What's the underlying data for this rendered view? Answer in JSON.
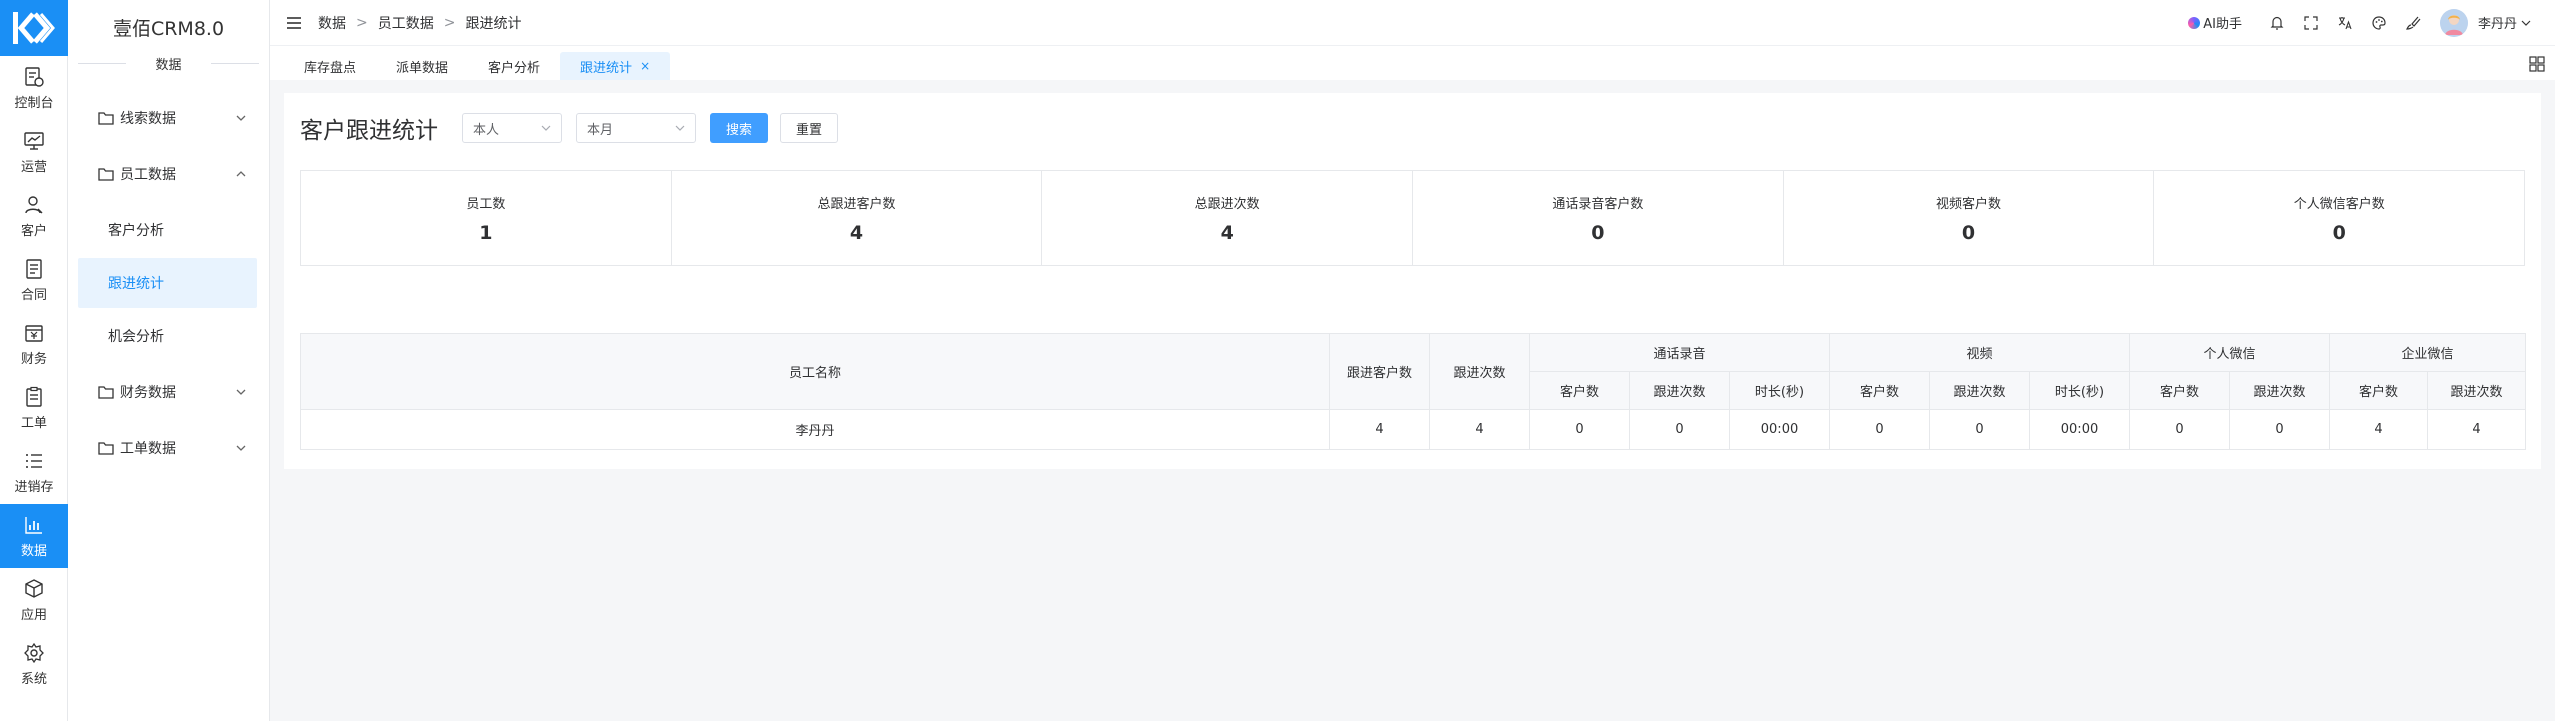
{
  "app": {
    "title": "壹佰CRM8.0",
    "section": "数据"
  },
  "rail": [
    {
      "label": "控制台",
      "icon": "dashboard-icon",
      "active": false
    },
    {
      "label": "运营",
      "icon": "chart-board-icon",
      "active": false
    },
    {
      "label": "客户",
      "icon": "user-icon",
      "active": false
    },
    {
      "label": "合同",
      "icon": "document-icon",
      "active": false
    },
    {
      "label": "财务",
      "icon": "finance-icon",
      "active": false
    },
    {
      "label": "工单",
      "icon": "clipboard-icon",
      "active": false
    },
    {
      "label": "进销存",
      "icon": "list-icon",
      "active": false
    },
    {
      "label": "数据",
      "icon": "bar-chart-icon",
      "active": true
    },
    {
      "label": "应用",
      "icon": "cube-icon",
      "active": false
    },
    {
      "label": "系统",
      "icon": "settings-icon",
      "active": false
    }
  ],
  "submenu": {
    "groups": [
      {
        "label": "线索数据",
        "expanded": false
      },
      {
        "label": "员工数据",
        "expanded": true,
        "children": [
          "客户分析",
          "跟进统计",
          "机会分析"
        ]
      },
      {
        "label": "财务数据",
        "expanded": false
      },
      {
        "label": "工单数据",
        "expanded": false
      }
    ]
  },
  "breadcrumb": [
    "数据",
    "员工数据",
    "跟进统计"
  ],
  "topbar": {
    "ai_label": "AI助手",
    "user_name": "李丹丹"
  },
  "tabs": [
    {
      "label": "库存盘点",
      "active": false
    },
    {
      "label": "派单数据",
      "active": false
    },
    {
      "label": "客户分析",
      "active": false
    },
    {
      "label": "跟进统计",
      "active": true,
      "close": "×"
    }
  ],
  "page": {
    "title": "客户跟进统计",
    "filter_scope": "本人",
    "filter_period": "本月",
    "search_label": "搜索",
    "reset_label": "重置"
  },
  "stats": [
    {
      "label": "员工数",
      "value": "1"
    },
    {
      "label": "总跟进客户数",
      "value": "4"
    },
    {
      "label": "总跟进次数",
      "value": "4"
    },
    {
      "label": "通话录音客户数",
      "value": "0"
    },
    {
      "label": "视频客户数",
      "value": "0"
    },
    {
      "label": "个人微信客户数",
      "value": "0"
    }
  ],
  "table": {
    "headers": {
      "name": "员工名称",
      "followed_customers": "跟进客户数",
      "follow_count": "跟进次数",
      "call": "通话录音",
      "video": "视频",
      "personal_wechat": "个人微信",
      "work_wechat": "企业微信",
      "customers": "客户数",
      "follows": "跟进次数",
      "duration": "时长(秒)"
    },
    "rows": [
      {
        "name": "李丹丹",
        "followed_customers": "4",
        "follow_count": "4",
        "call_customers": "0",
        "call_follows": "0",
        "call_duration": "00:00",
        "video_customers": "0",
        "video_follows": "0",
        "video_duration": "00:00",
        "pw_customers": "0",
        "pw_follows": "0",
        "ww_customers": "4",
        "ww_follows": "4"
      }
    ]
  },
  "colors": {
    "primary": "#1a8ff5",
    "button": "#409eff",
    "active_bg": "#e8f3fe"
  }
}
